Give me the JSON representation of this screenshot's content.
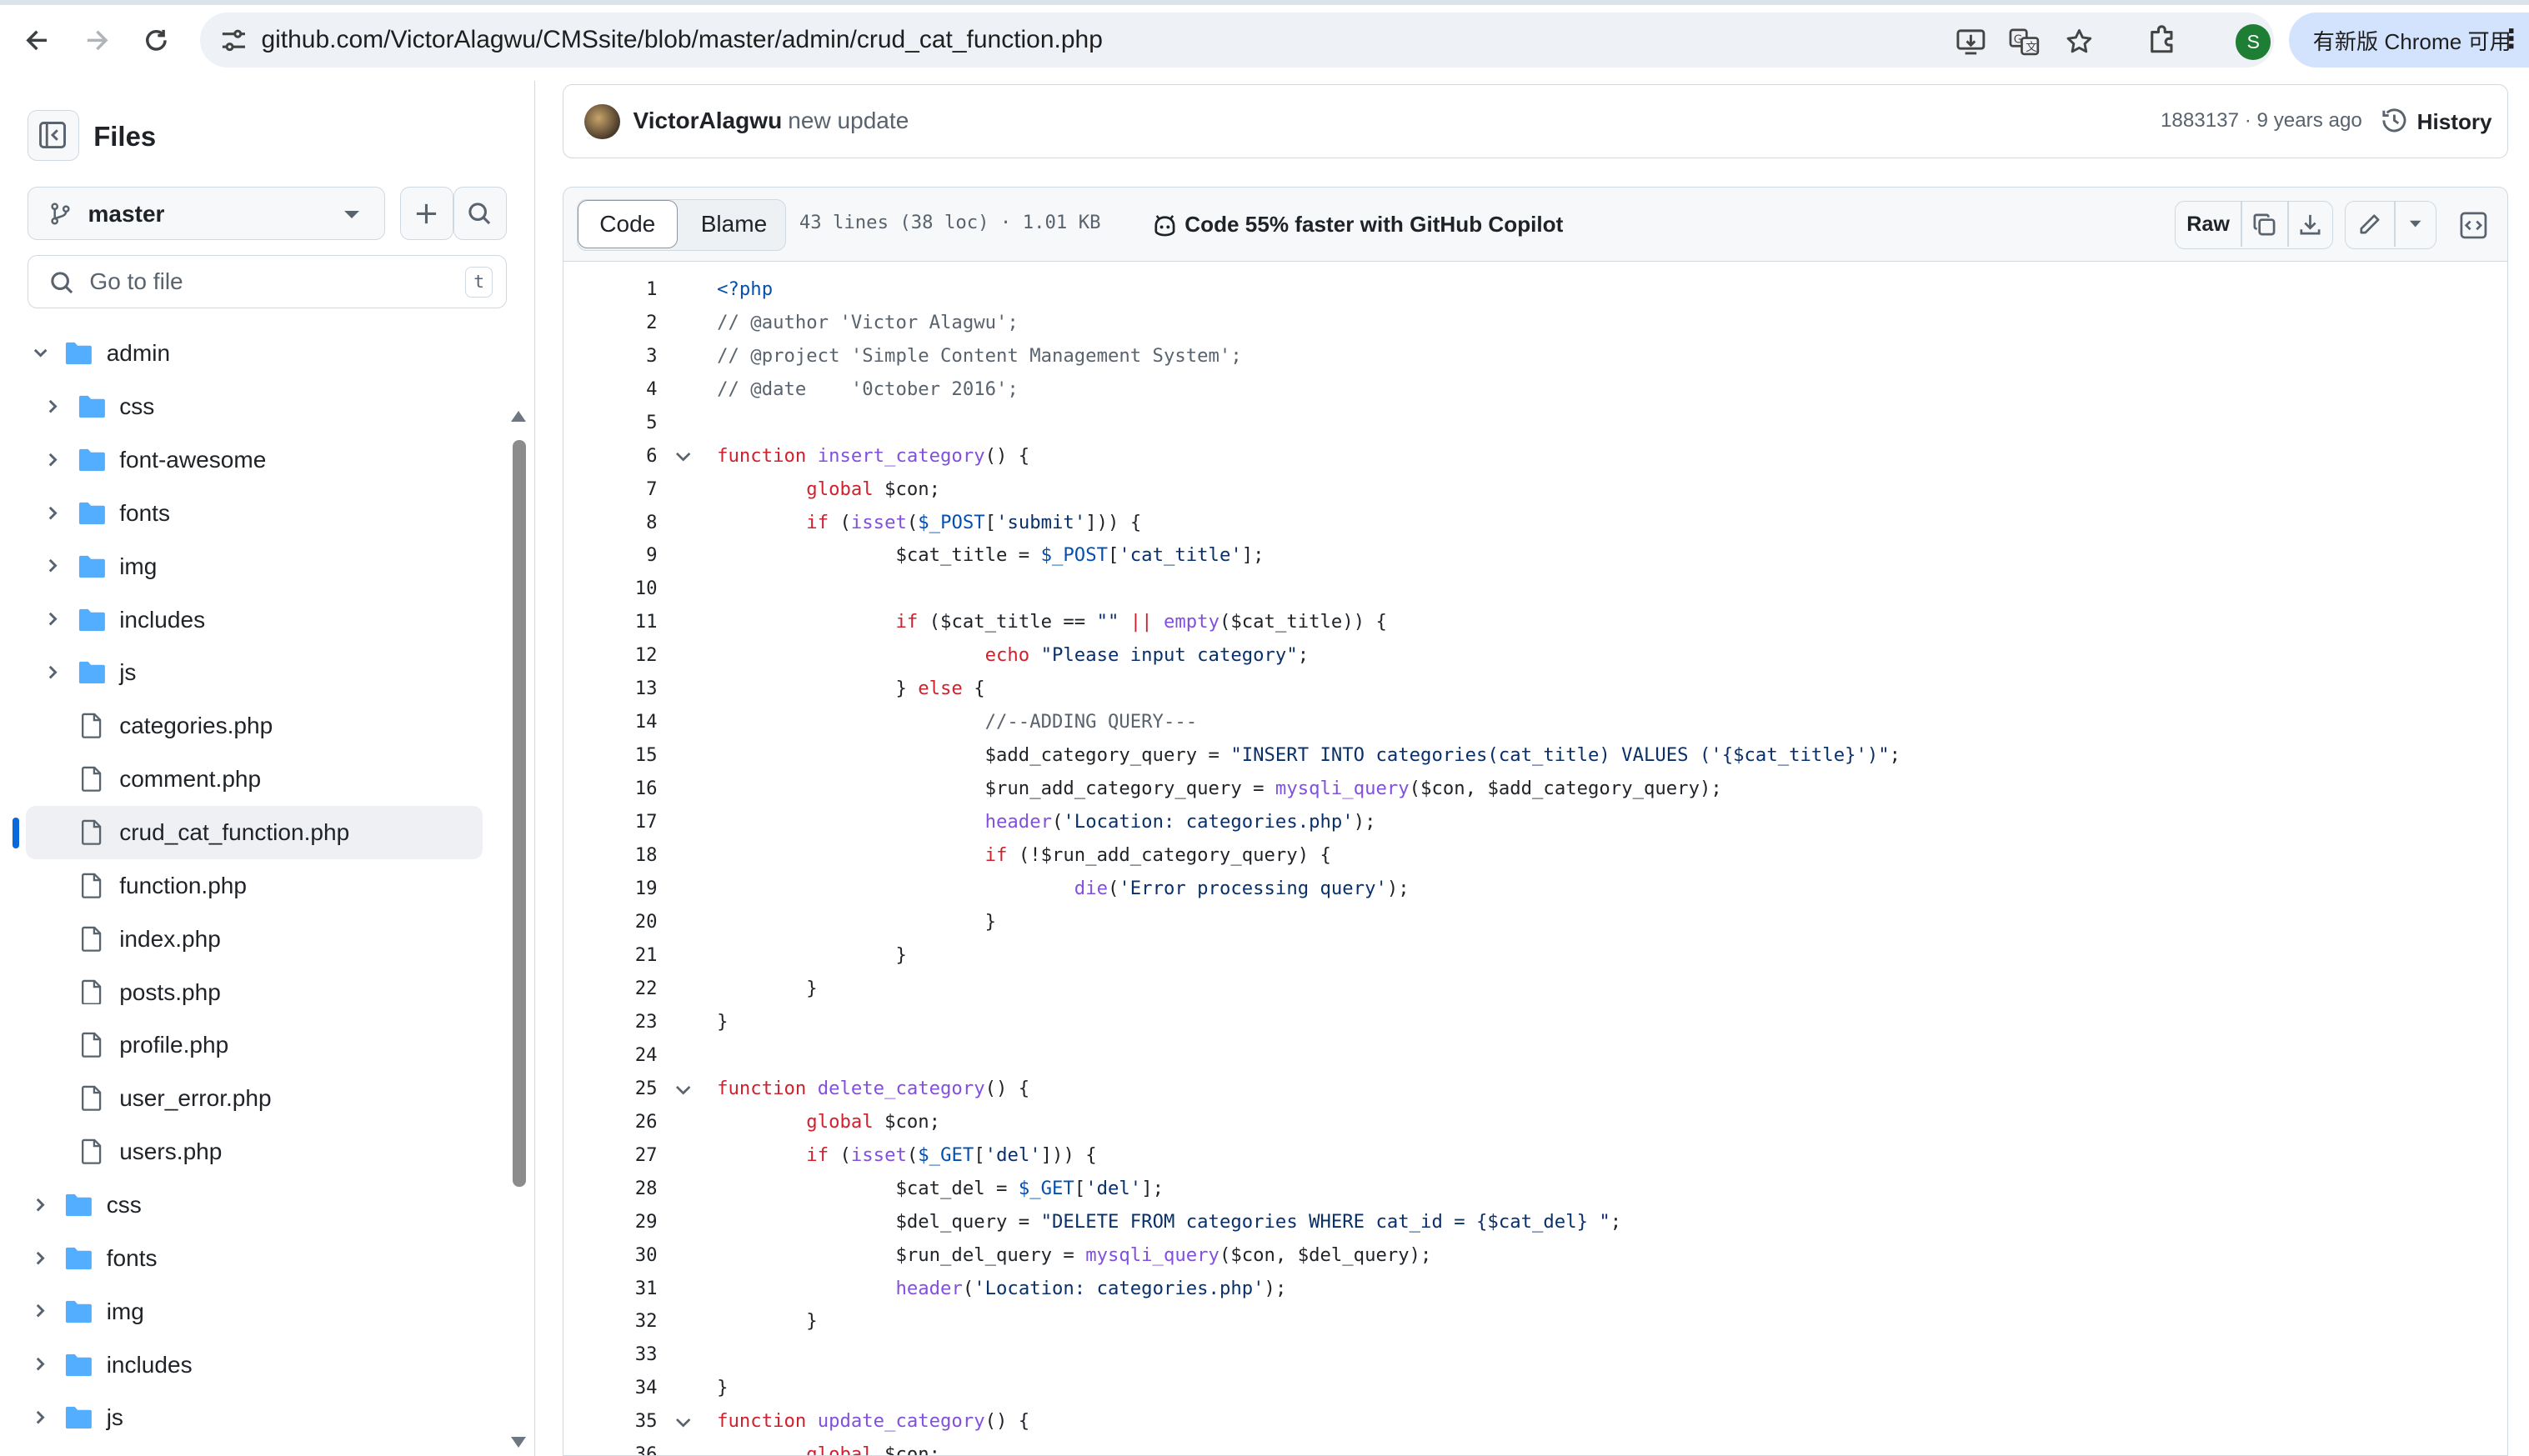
{
  "browser": {
    "url": "github.com/VictorAlagwu/CMSsite/blob/master/admin/crud_cat_function.php",
    "profile_initial": "S",
    "update_chip": "有新版 Chrome 可用"
  },
  "sidebar": {
    "title": "Files",
    "branch": "master",
    "search_placeholder": "Go to file",
    "search_shortcut": "t",
    "tree": [
      {
        "label": "admin",
        "type": "folder",
        "depth": 0,
        "expanded": true
      },
      {
        "label": "css",
        "type": "folder",
        "depth": 1
      },
      {
        "label": "font-awesome",
        "type": "folder",
        "depth": 1
      },
      {
        "label": "fonts",
        "type": "folder",
        "depth": 1
      },
      {
        "label": "img",
        "type": "folder",
        "depth": 1
      },
      {
        "label": "includes",
        "type": "folder",
        "depth": 1
      },
      {
        "label": "js",
        "type": "folder",
        "depth": 1
      },
      {
        "label": "categories.php",
        "type": "file",
        "depth": 1
      },
      {
        "label": "comment.php",
        "type": "file",
        "depth": 1
      },
      {
        "label": "crud_cat_function.php",
        "type": "file",
        "depth": 1,
        "active": true
      },
      {
        "label": "function.php",
        "type": "file",
        "depth": 1
      },
      {
        "label": "index.php",
        "type": "file",
        "depth": 1
      },
      {
        "label": "posts.php",
        "type": "file",
        "depth": 1
      },
      {
        "label": "profile.php",
        "type": "file",
        "depth": 1
      },
      {
        "label": "user_error.php",
        "type": "file",
        "depth": 1
      },
      {
        "label": "users.php",
        "type": "file",
        "depth": 1
      },
      {
        "label": "css",
        "type": "folder",
        "depth": 0
      },
      {
        "label": "fonts",
        "type": "folder",
        "depth": 0
      },
      {
        "label": "img",
        "type": "folder",
        "depth": 0
      },
      {
        "label": "includes",
        "type": "folder",
        "depth": 0
      },
      {
        "label": "js",
        "type": "folder",
        "depth": 0
      }
    ]
  },
  "commit": {
    "author": "VictorAlagwu",
    "message": "new update",
    "meta": "1883137 · 9 years ago",
    "history_label": "History"
  },
  "file_header": {
    "tab_code": "Code",
    "tab_blame": "Blame",
    "info": "43 lines (38 loc) · 1.01 KB",
    "copilot": "Code 55% faster with GitHub Copilot",
    "raw_label": "Raw"
  },
  "code": {
    "lines": [
      [
        [
          "v",
          "<?php"
        ]
      ],
      [
        [
          "c",
          "// @author 'Victor Alagwu';"
        ]
      ],
      [
        [
          "c",
          "// @project 'Simple Content Management System';"
        ]
      ],
      [
        [
          "c",
          "// @date    '0ctober 2016';"
        ]
      ],
      [],
      [
        [
          "k",
          "function "
        ],
        [
          "f",
          "insert_category"
        ],
        [
          "",
          "() {"
        ]
      ],
      [
        [
          "",
          "        "
        ],
        [
          "k",
          "global "
        ],
        [
          "",
          "$con;"
        ]
      ],
      [
        [
          "",
          "        "
        ],
        [
          "k",
          "if "
        ],
        [
          "",
          "("
        ],
        [
          "f",
          "isset"
        ],
        [
          "",
          "("
        ],
        [
          "v",
          "$_POST"
        ],
        [
          "",
          "["
        ],
        [
          "s",
          "'submit'"
        ],
        [
          "",
          "])) {"
        ]
      ],
      [
        [
          "",
          "                $cat_title = "
        ],
        [
          "v",
          "$_POST"
        ],
        [
          "",
          "["
        ],
        [
          "s",
          "'cat_title'"
        ],
        [
          "",
          "];"
        ]
      ],
      [],
      [
        [
          "",
          "                "
        ],
        [
          "k",
          "if "
        ],
        [
          "",
          "($cat_title == "
        ],
        [
          "s",
          "\"\""
        ],
        [
          "k",
          " || "
        ],
        [
          "f",
          "empty"
        ],
        [
          "",
          "($cat_title)) {"
        ]
      ],
      [
        [
          "",
          "                        "
        ],
        [
          "k",
          "echo "
        ],
        [
          "s",
          "\"Please input category\""
        ],
        [
          "",
          ";"
        ]
      ],
      [
        [
          "",
          "                } "
        ],
        [
          "k",
          "else "
        ],
        [
          "",
          "{"
        ]
      ],
      [
        [
          "",
          "                        "
        ],
        [
          "c",
          "//--ADDING QUERY---"
        ]
      ],
      [
        [
          "",
          "                        $add_category_query = "
        ],
        [
          "s",
          "\"INSERT INTO categories(cat_title) VALUES ('{$cat_title}')\""
        ],
        [
          "",
          ";"
        ]
      ],
      [
        [
          "",
          "                        $run_add_category_query = "
        ],
        [
          "f",
          "mysqli_query"
        ],
        [
          "",
          "($con, $add_category_query);"
        ]
      ],
      [
        [
          "",
          "                        "
        ],
        [
          "f",
          "header"
        ],
        [
          "",
          "("
        ],
        [
          "s",
          "'Location: categories.php'"
        ],
        [
          "",
          ");"
        ]
      ],
      [
        [
          "",
          "                        "
        ],
        [
          "k",
          "if "
        ],
        [
          "",
          "(!$run_add_category_query) {"
        ]
      ],
      [
        [
          "",
          "                                "
        ],
        [
          "f",
          "die"
        ],
        [
          "",
          "("
        ],
        [
          "s",
          "'Error processing query'"
        ],
        [
          "",
          ");"
        ]
      ],
      [
        [
          "",
          "                        }"
        ]
      ],
      [
        [
          "",
          "                }"
        ]
      ],
      [
        [
          "",
          "        }"
        ]
      ],
      [
        [
          "",
          "}"
        ]
      ],
      [],
      [
        [
          "k",
          "function "
        ],
        [
          "f",
          "delete_category"
        ],
        [
          "",
          "() {"
        ]
      ],
      [
        [
          "",
          "        "
        ],
        [
          "k",
          "global "
        ],
        [
          "",
          "$con;"
        ]
      ],
      [
        [
          "",
          "        "
        ],
        [
          "k",
          "if "
        ],
        [
          "",
          "("
        ],
        [
          "f",
          "isset"
        ],
        [
          "",
          "("
        ],
        [
          "v",
          "$_GET"
        ],
        [
          "",
          "["
        ],
        [
          "s",
          "'del'"
        ],
        [
          "",
          "])) {"
        ]
      ],
      [
        [
          "",
          "                $cat_del = "
        ],
        [
          "v",
          "$_GET"
        ],
        [
          "",
          "["
        ],
        [
          "s",
          "'del'"
        ],
        [
          "",
          "];"
        ]
      ],
      [
        [
          "",
          "                $del_query = "
        ],
        [
          "s",
          "\"DELETE FROM categories WHERE cat_id = {$cat_del} \""
        ],
        [
          "",
          ";"
        ]
      ],
      [
        [
          "",
          "                $run_del_query = "
        ],
        [
          "f",
          "mysqli_query"
        ],
        [
          "",
          "($con, $del_query);"
        ]
      ],
      [
        [
          "",
          "                "
        ],
        [
          "f",
          "header"
        ],
        [
          "",
          "("
        ],
        [
          "s",
          "'Location: categories.php'"
        ],
        [
          "",
          ");"
        ]
      ],
      [
        [
          "",
          "        }"
        ]
      ],
      [],
      [
        [
          "",
          "}"
        ]
      ],
      [
        [
          "k",
          "function "
        ],
        [
          "f",
          "update_category"
        ],
        [
          "",
          "() {"
        ]
      ],
      [
        [
          "",
          "        "
        ],
        [
          "k",
          "global "
        ],
        [
          "",
          "$con;"
        ]
      ]
    ],
    "fold_lines": [
      6,
      25,
      35
    ]
  }
}
